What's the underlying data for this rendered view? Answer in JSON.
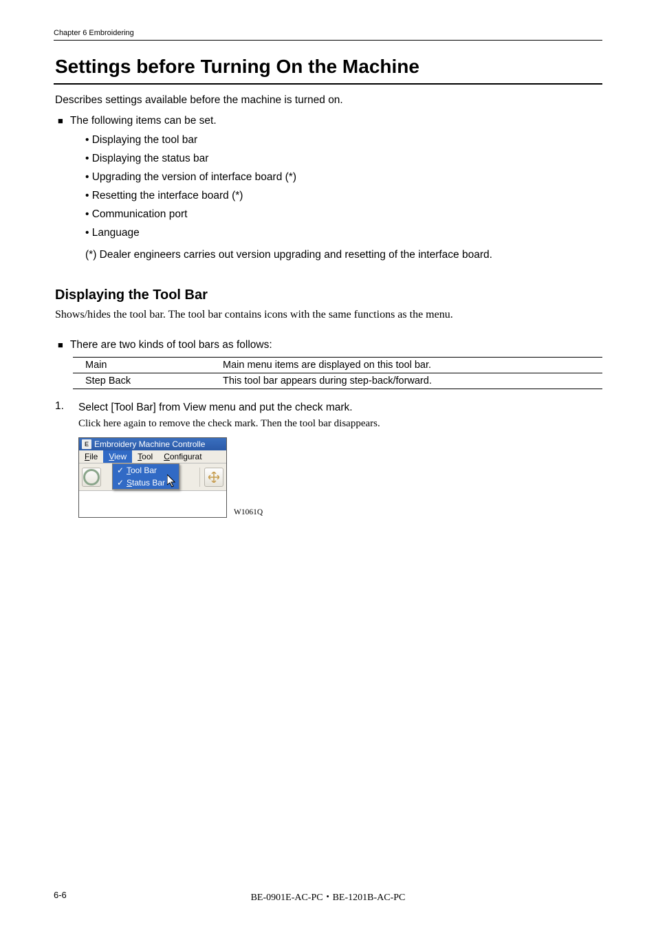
{
  "runningHead": "Chapter 6    Embroidering",
  "title": "Settings before Turning On the Machine",
  "intro": "Describes settings available before the machine is turned on.",
  "canSetLead": "The following items can be set.",
  "bullets": [
    "Displaying the tool bar",
    "Displaying the status bar",
    "Upgrading the version of interface board (*)",
    "Resetting the interface board (*)",
    "Communication port",
    "Language"
  ],
  "note": "(*) Dealer engineers carries out version upgrading and resetting of the interface board.",
  "section1": {
    "heading": "Displaying the Tool Bar",
    "desc": "Shows/hides the tool bar.    The tool bar contains icons with the same functions as the menu.",
    "twoKinds": "There are two kinds of tool bars as follows:",
    "table": [
      {
        "name": "Main",
        "desc": "Main menu items are displayed on this tool bar."
      },
      {
        "name": "Step Back",
        "desc": "This tool bar appears during step-back/forward."
      }
    ],
    "step1_num": "1.",
    "step1": "Select [Tool Bar] from View menu and put the check mark.",
    "step1_sub": "Click here again to remove the check mark.    Then the tool bar disappears."
  },
  "screenshot": {
    "windowTitle": "Embroidery Machine Controlle",
    "menus": {
      "file_pre": "F",
      "file_rest": "ile",
      "view_pre": "V",
      "view_rest": "iew",
      "tool_pre": "T",
      "tool_rest": "ool",
      "conf_pre": "C",
      "conf_rest": "onfigurat"
    },
    "dropdown": {
      "item1_chk": "✓",
      "item1_pre": "T",
      "item1_rest": "ool Bar",
      "item2_chk": "✓",
      "item2_pre": "S",
      "item2_rest": "tatus Bar"
    },
    "code": "W1061Q"
  },
  "footer": {
    "left": "6-6",
    "center": "BE-0901E-AC-PC・BE-1201B-AC-PC"
  }
}
